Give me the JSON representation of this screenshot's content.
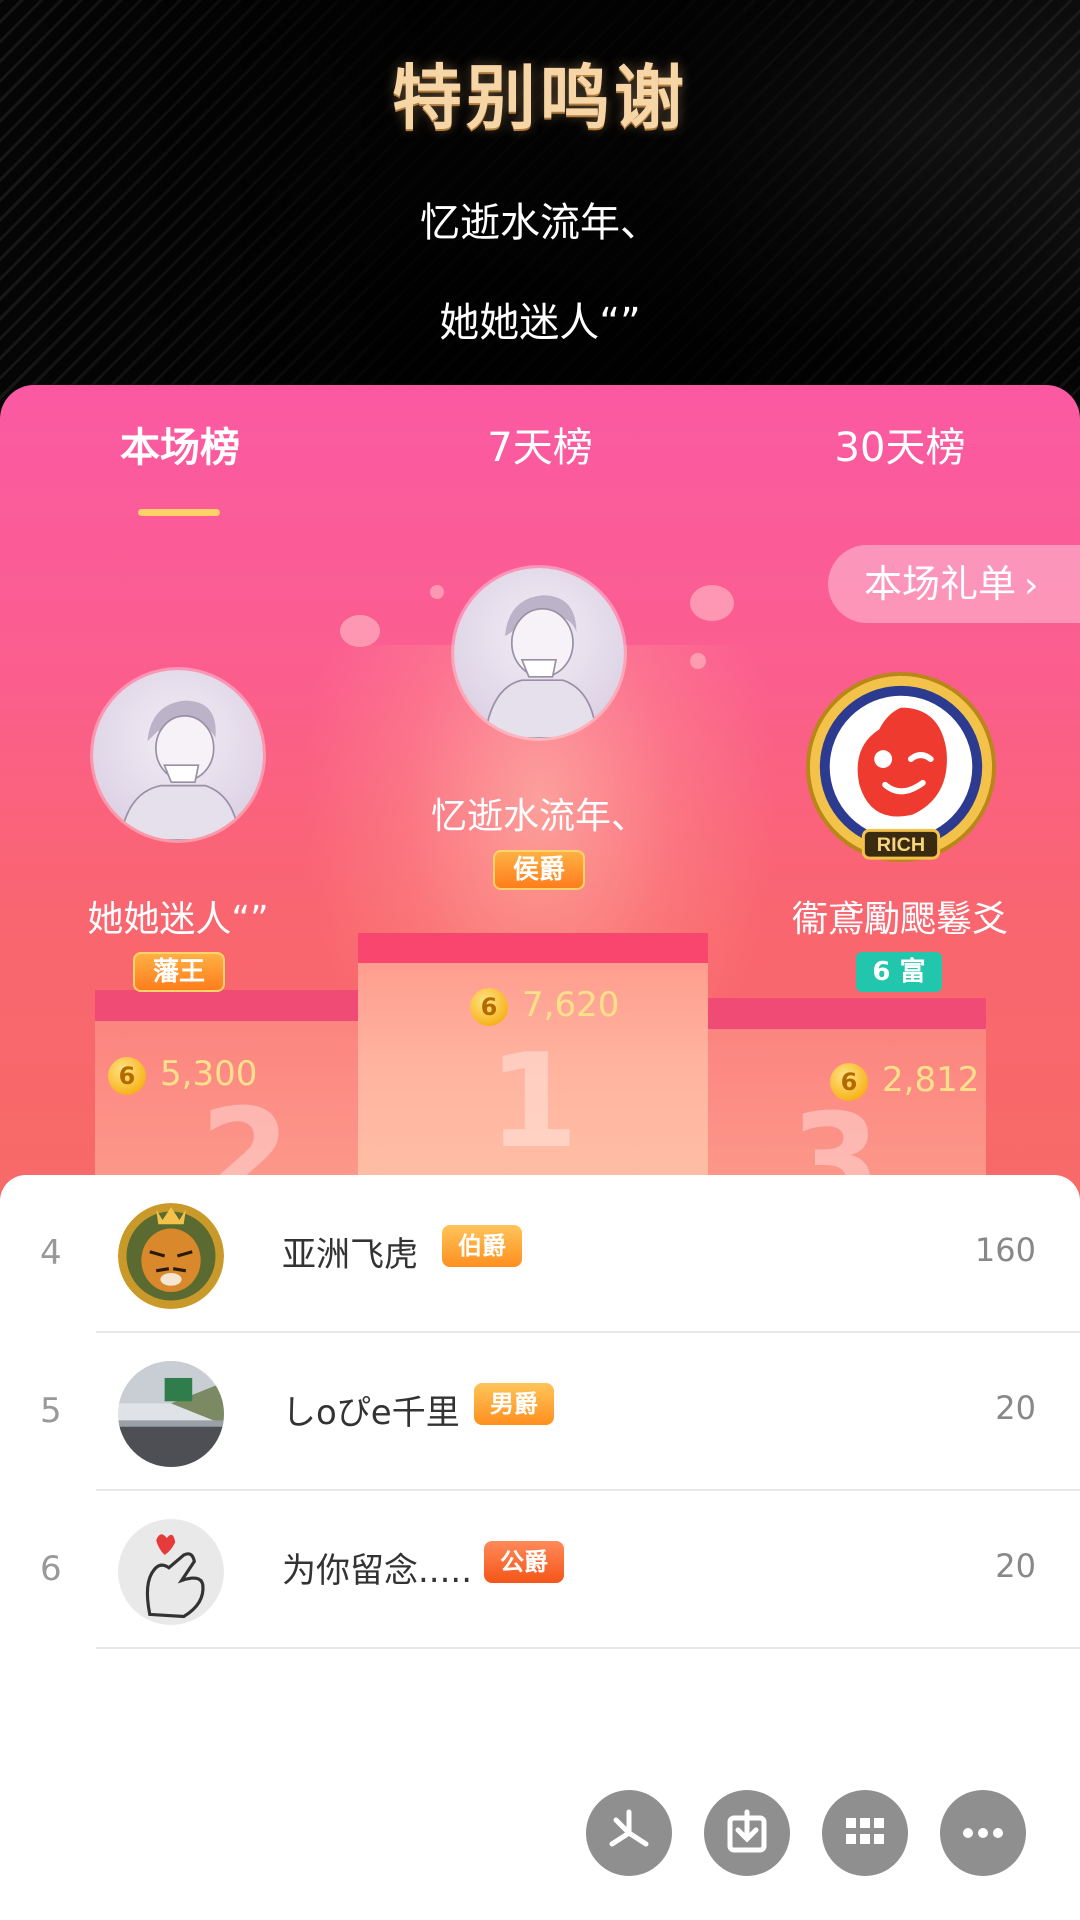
{
  "header": {
    "title": "特别鸣谢",
    "thanks_line1": "忆逝水流年、",
    "thanks_line2": "她她迷人“”"
  },
  "tabs": [
    {
      "label": "本场榜",
      "active": true
    },
    {
      "label": "7天榜",
      "active": false
    },
    {
      "label": "30天榜",
      "active": false
    }
  ],
  "gift_list_button": "本场礼单",
  "podium": {
    "first": {
      "name": "忆逝水流年、",
      "tag": "侯爵",
      "score": "7,620",
      "rank_mark": "1"
    },
    "second": {
      "name": "她她迷人“”",
      "tag": "藩王",
      "score": "5,300",
      "rank_mark": "2"
    },
    "third": {
      "name": "衞鳶勵颸鬈爻",
      "tag": "6 富",
      "score": "2,812",
      "rank_mark": "3",
      "badge_text": "RICH"
    }
  },
  "coin_symbol": "6",
  "list": [
    {
      "rank": "4",
      "name": "亚洲飞虎",
      "tag": "伯爵",
      "value": "160"
    },
    {
      "rank": "5",
      "name": "しoぴe千里",
      "tag": "男爵",
      "value": "20"
    },
    {
      "rank": "6",
      "name": "为你留念.....",
      "tag": "公爵",
      "value": "20"
    }
  ],
  "colors": {
    "card_pink": "#fb5aa3",
    "tab_underline": "#ffd166",
    "score_gold": "#ffe08a",
    "rich_tag_green": "#21c6ac"
  },
  "actions": [
    {
      "icon": "pinwheel-icon"
    },
    {
      "icon": "download-icon"
    },
    {
      "icon": "grid-icon"
    },
    {
      "icon": "more-icon"
    }
  ]
}
